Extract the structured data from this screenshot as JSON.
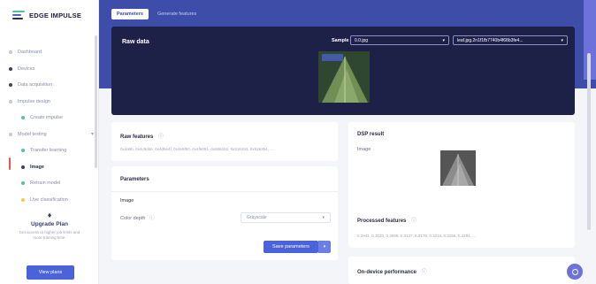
{
  "sidebar": {
    "logo_text": "EDGE IMPULSE",
    "items": [
      {
        "label": "Dashboard"
      },
      {
        "label": "Devices"
      },
      {
        "label": "Data acquisition"
      },
      {
        "label": "Impulse design"
      },
      {
        "label": "Create impulse"
      },
      {
        "label": "Image"
      },
      {
        "label": "Transfer learning"
      },
      {
        "label": "Retrain model"
      },
      {
        "label": "Live classification"
      },
      {
        "label": "Model testing"
      }
    ],
    "upgrade": {
      "title": "Upgrade Plan",
      "text": "Get access to higher job limits and more training time.",
      "button": "View plans"
    }
  },
  "tabs": [
    {
      "label": "Parameters"
    },
    {
      "label": "Generate features"
    }
  ],
  "raw_data": {
    "title": "Raw data",
    "sample_label": "Sample",
    "sample_value": "0.0.jpg",
    "file_value": "leaf.jpg.2n1f1fb7740b4f68b3fe4..."
  },
  "raw_features": {
    "title": "Raw features",
    "values": "0x4a5b, 0x4c5d4e, 0x4d5e4f, 0x4e5f50, 0x4f6051, 0x506152, 0x516253, 0x526354, ..."
  },
  "parameters": {
    "title": "Parameters",
    "section": "Image",
    "color_depth_label": "Color depth",
    "color_depth_value": "Grayscale",
    "save_button": "Save parameters"
  },
  "dsp_result": {
    "title": "DSP result",
    "image_label": "Image",
    "processed_title": "Processed features",
    "processed_values": "0.2941, 0.3020, 0.3098, 0.3137, 0.3176, 0.3216, 0.3255, 0.3294, ..."
  },
  "performance": {
    "title": "On-device performance"
  },
  "colors": {
    "accent": "#4b63d8",
    "header_band": "#3d4da8",
    "raw_panel": "#1d2147"
  },
  "icons": {
    "logo": "edge-impulse-logo-icon",
    "help": "question-circle-icon",
    "chat": "chat-icon"
  }
}
